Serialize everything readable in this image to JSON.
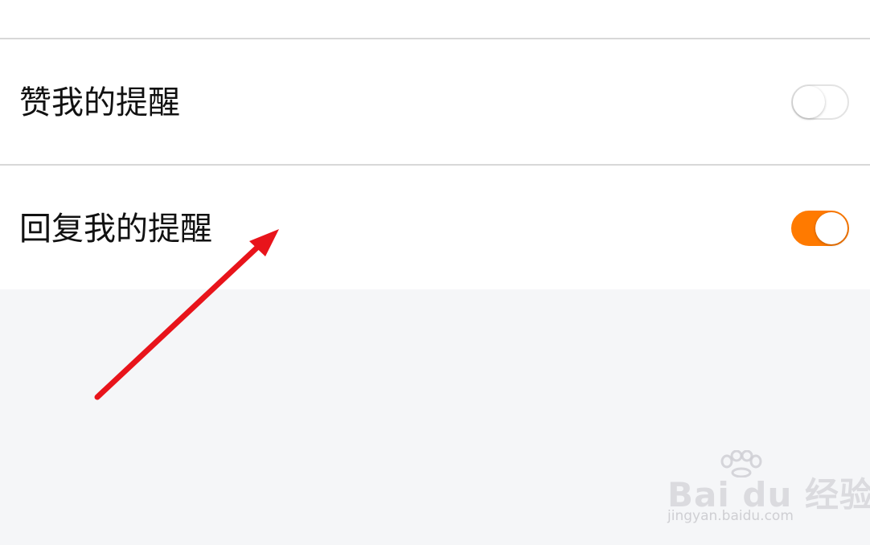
{
  "settings": {
    "rows": [
      {
        "label": "赞我的提醒",
        "enabled": false
      },
      {
        "label": "回复我的提醒",
        "enabled": true
      }
    ]
  },
  "colors": {
    "toggle_on": "#ff7a00",
    "toggle_off_border": "#e3e3e3",
    "annotation_arrow": "#e8141b",
    "page_background": "#f5f6f8"
  },
  "watermark": {
    "brand": "Bai du 经验",
    "url": "jingyan.baidu.com"
  }
}
